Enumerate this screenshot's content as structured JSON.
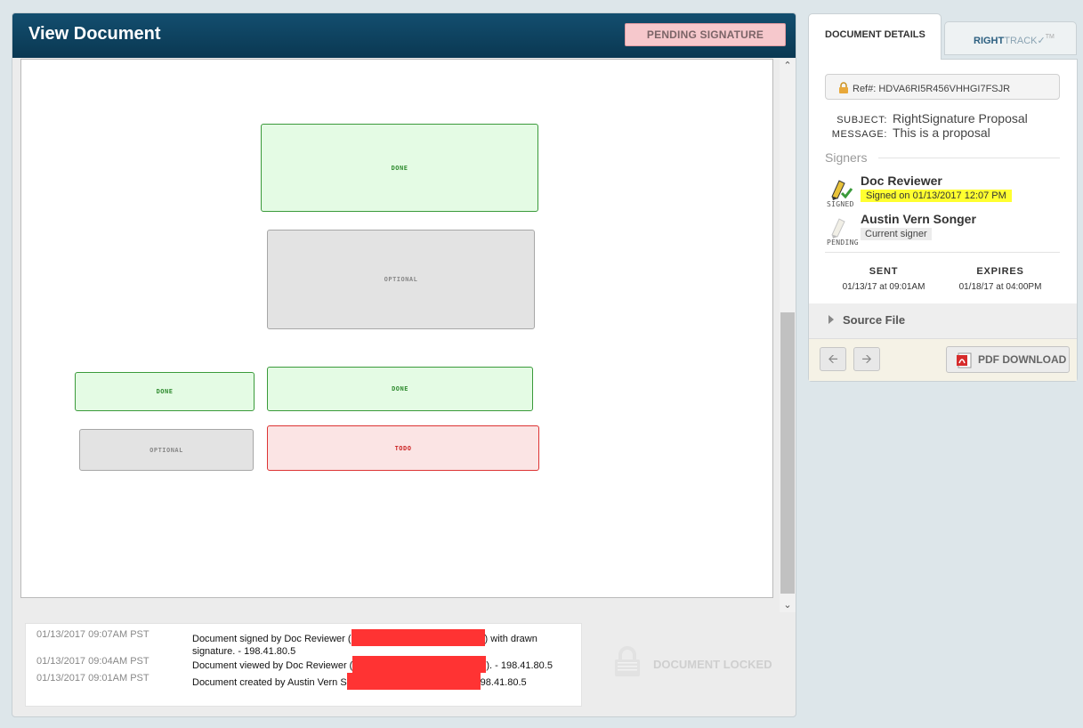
{
  "header": {
    "title": "View Document",
    "status_label": "PENDING SIGNATURE"
  },
  "fields": [
    {
      "state": "done",
      "label": "DONE"
    },
    {
      "state": "optional",
      "label": "OPTIONAL"
    },
    {
      "state": "done",
      "label": "DONE"
    },
    {
      "state": "done",
      "label": "DONE"
    },
    {
      "state": "optional",
      "label": "OPTIONAL"
    },
    {
      "state": "todo",
      "label": "TODO"
    }
  ],
  "audit_log": [
    {
      "time": "01/13/2017 09:07AM PST",
      "before": "Document signed by Doc Reviewer (",
      "after": ") with drawn signature. - 198.41.80.5"
    },
    {
      "time": "01/13/2017 09:04AM PST",
      "before": "Document viewed by Doc Reviewer (",
      "after": "). - 198.41.80.5"
    },
    {
      "time": "01/13/2017 09:01AM PST",
      "before": "Document created by Austin Vern S",
      "after": "98.41.80.5"
    }
  ],
  "locked_label": "DOCUMENT LOCKED",
  "tabs": {
    "details": "DOCUMENT DETAILS",
    "track_brand": "RIGHT",
    "track_brand2": "TRACK",
    "track_tm": "TM"
  },
  "details": {
    "ref": "Ref#: HDVA6RI5R456VHHGI7FSJR",
    "subject_label": "SUBJECT:",
    "subject": "RightSignature Proposal",
    "message_label": "MESSAGE:",
    "message": "This is a proposal",
    "signers_title": "Signers",
    "signers": [
      {
        "name": "Doc Reviewer",
        "status": "SIGNED",
        "badge": "Signed on 01/13/2017 12:07 PM"
      },
      {
        "name": "Austin Vern Songer",
        "status": "PENDING",
        "badge": "Current signer"
      }
    ],
    "sent_label": "SENT",
    "sent_value": "01/13/17 at 09:01AM",
    "expires_label": "EXPIRES",
    "expires_value": "01/18/17 at 04:00PM",
    "source_file": "Source File",
    "pdf_download": "PDF DOWNLOAD"
  },
  "colors": {
    "header": "#0a3852",
    "status_bg": "#f6c8cc",
    "done": "#3a9a3a",
    "todo": "#dd3333",
    "highlight": "#ffff30"
  },
  "icons": [
    "lock-icon",
    "arrow-left-icon",
    "arrow-right-icon",
    "pdf-icon",
    "pen-signed-icon",
    "pen-pending-icon",
    "triangle-right-icon",
    "chevron-up-icon",
    "chevron-down-icon"
  ]
}
